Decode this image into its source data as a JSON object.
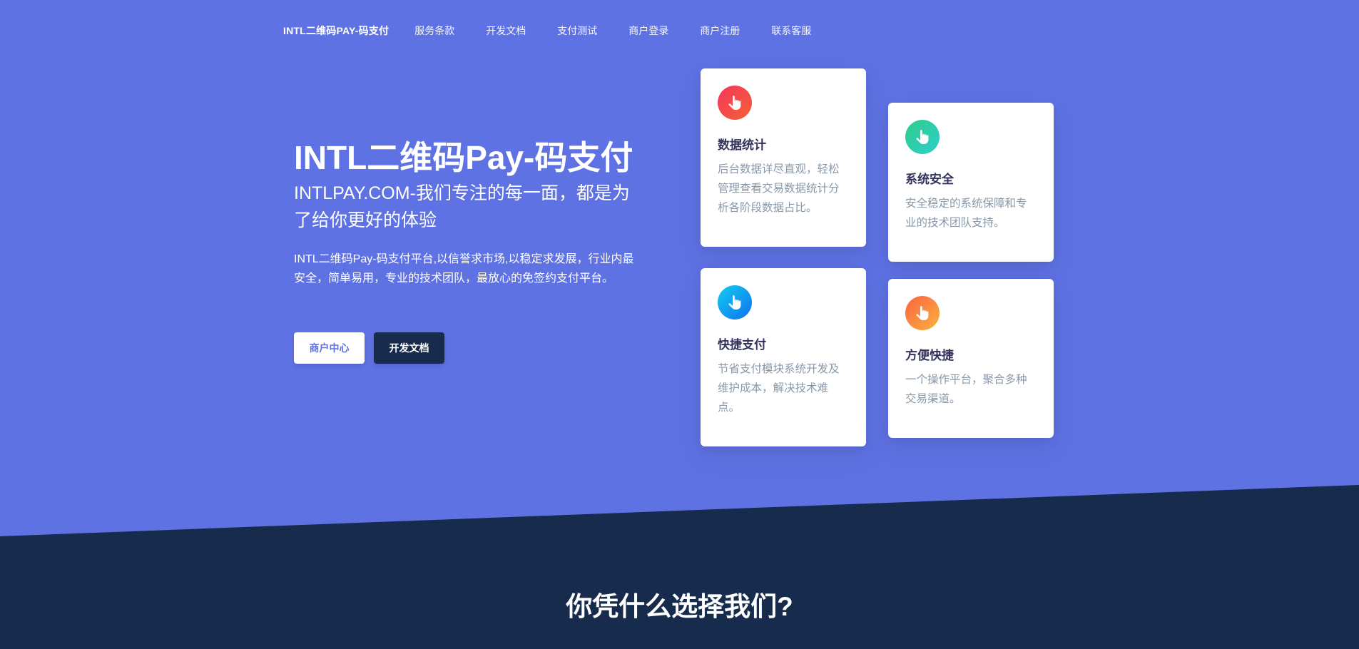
{
  "nav": {
    "brand": "INTL二维码PAY-码支付",
    "links": [
      "服务条款",
      "开发文档",
      "支付测试",
      "商户登录",
      "商户注册",
      "联系客服"
    ]
  },
  "hero": {
    "title": "INTL二维码Pay-码支付",
    "subtitle": "INTLPAY.COM-我们专注的每一面，都是为了给你更好的体验",
    "description": "INTL二维码Pay-码支付平台,以信誉求市场,以稳定求发展，行业内最安全，简单易用，专业的技术团队，最放心的免签约支付平台。",
    "btn_merchant": "商户中心",
    "btn_docs": "开发文档"
  },
  "cards": [
    {
      "title": "数据统计",
      "text": "后台数据详尽直观，轻松管理查看交易数据统计分析各阶段数据占比。",
      "icon": "hand-pointer-icon",
      "color": "#f5365c"
    },
    {
      "title": "系统安全",
      "text": "安全稳定的系统保障和专业的技术团队支持。",
      "icon": "hand-pointer-icon",
      "color": "#2dce89"
    },
    {
      "title": "快捷支付",
      "text": "节省支付模块系统开发及维护成本，解决技术难点。",
      "icon": "hand-pointer-icon",
      "color": "#11cdef"
    },
    {
      "title": "方便快捷",
      "text": "一个操作平台，聚合多种交易渠道。",
      "icon": "hand-pointer-icon",
      "color": "#fb6340"
    }
  ],
  "section": {
    "heading": "你凭什么选择我们?",
    "subtext": ""
  },
  "colors": {
    "primary": "#5f72e4",
    "dark": "#172b4d",
    "white": "#ffffff"
  }
}
